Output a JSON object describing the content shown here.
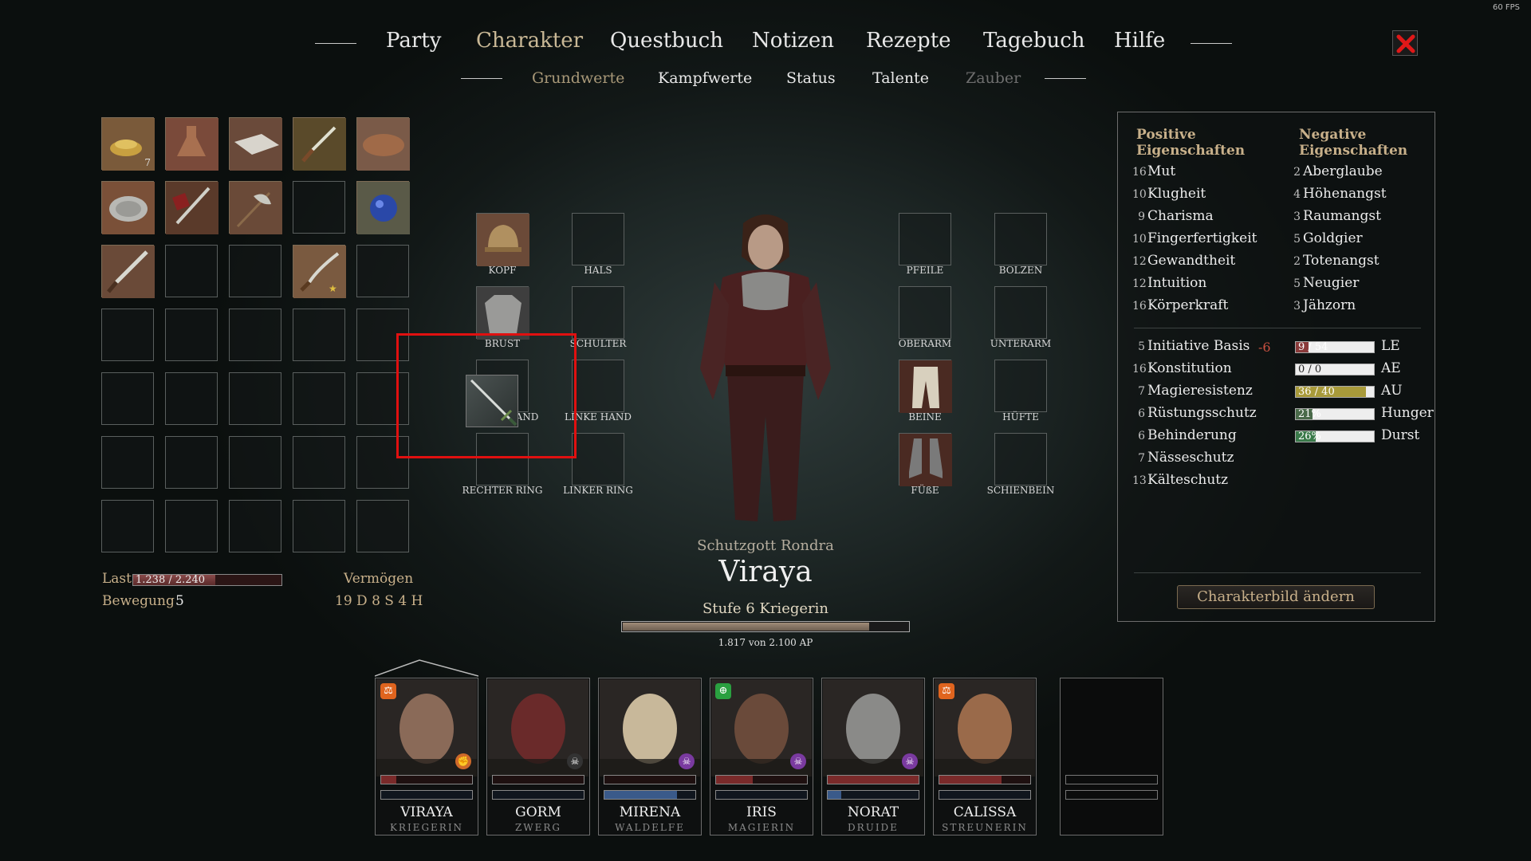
{
  "fps": "60 FPS",
  "nav": {
    "main": [
      "Party",
      "Charakter",
      "Questbuch",
      "Notizen",
      "Rezepte",
      "Tagebuch",
      "Hilfe"
    ],
    "active_main": "Charakter",
    "sub": [
      "Grundwerte",
      "Kampfwerte",
      "Status",
      "Talente",
      "Zauber"
    ],
    "active_sub": "Grundwerte",
    "disabled_sub": "Zauber"
  },
  "inventory": {
    "rows": [
      [
        {
          "item": "bowl-of-food",
          "qty": "7"
        },
        {
          "item": "flask"
        },
        {
          "item": "cloth"
        },
        {
          "item": "dagger"
        },
        {
          "item": "bedroll"
        }
      ],
      [
        {
          "item": "plate"
        },
        {
          "item": "sword-and-shield"
        },
        {
          "item": "battle-axe"
        },
        {
          "item": ""
        },
        {
          "item": "blue-gem"
        }
      ],
      [
        {
          "item": "short-sword"
        },
        {
          "item": ""
        },
        {
          "item": ""
        },
        {
          "item": "saber"
        },
        {
          "item": ""
        }
      ],
      [
        {
          "item": ""
        },
        {
          "item": ""
        },
        {
          "item": ""
        },
        {
          "item": ""
        },
        {
          "item": ""
        }
      ],
      [
        {
          "item": ""
        },
        {
          "item": ""
        },
        {
          "item": ""
        },
        {
          "item": ""
        },
        {
          "item": ""
        }
      ],
      [
        {
          "item": ""
        },
        {
          "item": ""
        },
        {
          "item": ""
        },
        {
          "item": ""
        },
        {
          "item": ""
        }
      ],
      [
        {
          "item": ""
        },
        {
          "item": ""
        },
        {
          "item": ""
        },
        {
          "item": ""
        },
        {
          "item": ""
        }
      ]
    ],
    "last_label": "Last",
    "last_value": "1.238 / 2.240",
    "last_fraction": 0.553,
    "bewegung_label": "Bewegung",
    "bewegung_value": "5",
    "vermoegen_label": "Vermögen",
    "vermoegen_value": "19 D 8 S 4 H"
  },
  "equipment": {
    "kopf": "KOPF",
    "hals": "HALS",
    "brust": "BRUST",
    "schulter": "SCHULTER",
    "rechte_hand": "AND",
    "linke_hand": "LINKE HAND",
    "rechter_ring": "RECHTER RING",
    "linker_ring": "LINKER RING",
    "pfeile": "PFEILE",
    "bolzen": "BOLZEN",
    "oberarm": "OBERARM",
    "unterarm": "UNTERARM",
    "beine": "BEINE",
    "huefte": "HÜFTE",
    "fuesse": "FÜßE",
    "schienbein": "SCHIENBEIN"
  },
  "character": {
    "deity": "Schutzgott Rondra",
    "name": "Viraya",
    "level": "Stufe 6 Kriegerin",
    "ap_text": "1.817 von 2.100 AP",
    "ap_fraction": 0.865
  },
  "stats": {
    "positive_heading": "Positive Eigenschaften",
    "negative_heading": "Negative Eigenschaften",
    "positive": [
      {
        "num": "16",
        "name": "Mut"
      },
      {
        "num": "10",
        "name": "Klugheit"
      },
      {
        "num": "9",
        "name": "Charisma"
      },
      {
        "num": "10",
        "name": "Fingerfertigkeit"
      },
      {
        "num": "12",
        "name": "Gewandtheit"
      },
      {
        "num": "12",
        "name": "Intuition"
      },
      {
        "num": "16",
        "name": "Körperkraft"
      }
    ],
    "negative": [
      {
        "num": "2",
        "name": "Aberglaube"
      },
      {
        "num": "4",
        "name": "Höhenangst"
      },
      {
        "num": "3",
        "name": "Raumangst"
      },
      {
        "num": "5",
        "name": "Goldgier"
      },
      {
        "num": "2",
        "name": "Totenangst"
      },
      {
        "num": "5",
        "name": "Neugier"
      },
      {
        "num": "3",
        "name": "Jähzorn"
      }
    ],
    "derived": [
      {
        "num": "5",
        "name": "Initiative Basis",
        "mod": "-6"
      },
      {
        "num": "16",
        "name": "Konstitution"
      },
      {
        "num": "7",
        "name": "Magieresistenz"
      },
      {
        "num": "6",
        "name": "Rüstungsschutz"
      },
      {
        "num": "6",
        "name": "Behinderung"
      },
      {
        "num": "7",
        "name": "Nässeschutz"
      },
      {
        "num": "13",
        "name": "Kälteschutz"
      }
    ],
    "resources": [
      {
        "text": "9 / 54",
        "label": "LE",
        "fraction": 0.167,
        "color": "#8a3a3a"
      },
      {
        "text": "0 / 0",
        "label": "AE",
        "fraction": 0,
        "color": "#3a5a8a"
      },
      {
        "text": "36 / 40",
        "label": "AU",
        "fraction": 0.9,
        "color": "#a89a3a"
      },
      {
        "text": "21%",
        "label": "Hunger",
        "fraction": 0.21,
        "color": "#4a6a4a"
      },
      {
        "text": "26%",
        "label": "Durst",
        "fraction": 0.26,
        "color": "#3a7a4a"
      }
    ],
    "charbild_button": "Charakterbild ändern"
  },
  "party": [
    {
      "name": "VIRAYA",
      "class": "KRIEGERIN",
      "hp": 0.17,
      "mp": 0,
      "badge": "⚖",
      "badge_color": "#e0641e",
      "skull": "✊",
      "skull_color": "#d06a2a",
      "portrait_color": "#8a6a58"
    },
    {
      "name": "GORM",
      "class": "ZWERG",
      "hp": 0,
      "mp": 0,
      "badge": "",
      "badge_color": "",
      "skull": "☠",
      "skull_color": "#333",
      "portrait_color": "#6a2a2a"
    },
    {
      "name": "MIRENA",
      "class": "WALDELFE",
      "hp": 0,
      "mp": 0.8,
      "badge": "",
      "badge_color": "",
      "skull": "☠",
      "skull_color": "#7a3aa0",
      "portrait_color": "#c8b89a"
    },
    {
      "name": "IRIS",
      "class": "MAGIERIN",
      "hp": 0.4,
      "mp": 0,
      "badge": "⊕",
      "badge_color": "#2aa040",
      "skull": "☠",
      "skull_color": "#7a3aa0",
      "portrait_color": "#6a4a3a"
    },
    {
      "name": "NORAT",
      "class": "DRUIDE",
      "hp": 1.0,
      "mp": 0.15,
      "badge": "",
      "badge_color": "",
      "skull": "☠",
      "skull_color": "#7a3aa0",
      "portrait_color": "#8a8a88"
    },
    {
      "name": "CALISSA",
      "class": "STREUNERIN",
      "hp": 0.68,
      "mp": 0,
      "badge": "⚖",
      "badge_color": "#e0641e",
      "skull": "",
      "skull_color": "",
      "portrait_color": "#9a6a4a"
    }
  ]
}
